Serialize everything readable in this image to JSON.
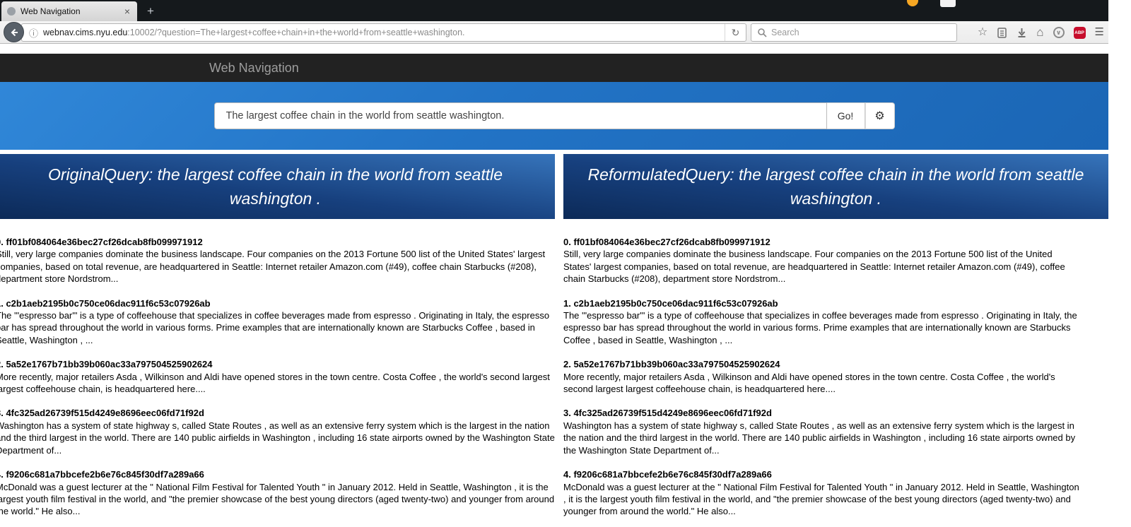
{
  "browser": {
    "tab_title": "Web Navigation",
    "url_host": "webnav.cims.nyu.edu",
    "url_rest": ":10002/?question=The+largest+coffee+chain+in+the+world+from+seattle+washington.",
    "search_placeholder": "Search",
    "abp_label": "ABP"
  },
  "icons": {
    "close": "×",
    "new_tab": "+",
    "info": "ⓘ",
    "reload": "↻",
    "star": "☆",
    "home": "⌂",
    "menu": "☰",
    "gear": "⚙",
    "pocket_chevron": "∨"
  },
  "page": {
    "brand": "Web Navigation",
    "query_value": "The largest coffee chain in the world from seattle washington.",
    "go_label": "Go!",
    "left_header": "OriginalQuery: the largest coffee chain in the world from seattle washington .",
    "right_header": "ReformulatedQuery: the largest coffee chain in the world from seattle washington ."
  },
  "results": [
    {
      "id": "0. ff01bf084064e36bec27cf26dcab8fb099971912",
      "snippet": "Still, very large companies dominate the business landscape. Four companies on the 2013 Fortune 500 list of the United States' largest companies, based on total revenue, are headquartered in Seattle: Internet retailer Amazon.com (#49), coffee chain Starbucks (#208), department store Nordstrom..."
    },
    {
      "id": "1. c2b1aeb2195b0c750ce06dac911f6c53c07926ab",
      "snippet": "The '\"espresso bar'\" is a type of coffeehouse that specializes in coffee beverages made from espresso . Originating in Italy, the espresso bar has spread throughout the world in various forms. Prime examples that are internationally known are Starbucks Coffee , based in Seattle, Washington , ..."
    },
    {
      "id": "2. 5a52e1767b71bb39b060ac33a797504525902624",
      "snippet": "More recently, major retailers Asda , Wilkinson and Aldi have opened stores in the town centre. Costa Coffee , the world's second largest largest coffeehouse chain, is headquartered here...."
    },
    {
      "id": "3. 4fc325ad26739f515d4249e8696eec06fd71f92d",
      "snippet": "Washington has a system of state highway s, called State Routes , as well as an extensive ferry system which is the largest in the nation and the third largest in the world. There are 140 public airfields in Washington , including 16 state airports owned by the Washington State Department of..."
    },
    {
      "id": "4. f9206c681a7bbcefe2b6e76c845f30df7a289a66",
      "snippet": "McDonald was a guest lecturer at the \" National Film Festival for Talented Youth \" in January 2012. Held in Seattle, Washington , it is the largest youth film festival in the world, and \"the premier showcase of the best young directors (aged twenty-two) and younger from around the world.\" He also..."
    }
  ]
}
